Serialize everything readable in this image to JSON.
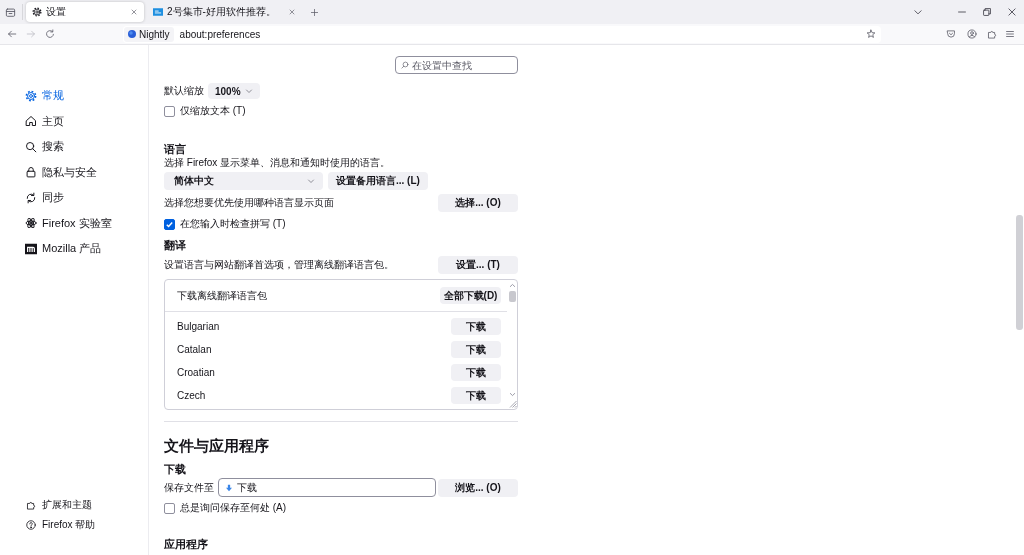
{
  "tabs": [
    {
      "title": "设置",
      "selected": true
    },
    {
      "title": "2号集市-好用软件推荐。",
      "selected": false
    }
  ],
  "toolbar": {
    "nav_buttons": [
      {
        "disabled": false
      },
      {
        "disabled": true
      },
      {
        "disabled": false
      }
    ],
    "identity": "Nightly",
    "url": "about:preferences"
  },
  "sidebar": {
    "items": [
      {
        "label": "常规",
        "selected": true
      },
      {
        "label": "主页",
        "selected": false
      },
      {
        "label": "搜索",
        "selected": false
      },
      {
        "label": "隐私与安全",
        "selected": false
      },
      {
        "label": "同步",
        "selected": false
      },
      {
        "label": "Firefox 实验室",
        "selected": false
      },
      {
        "label": "Mozilla 产品",
        "selected": false
      }
    ],
    "footer_links": [
      "扩展和主题",
      "Firefox 帮助"
    ]
  },
  "search": {
    "placeholder": "在设置中查找"
  },
  "zoom": {
    "label": "默认缩放",
    "value": "100%"
  },
  "zoom_text_only": {
    "label": "仅缩放文本 (T)",
    "checked": false
  },
  "language": {
    "heading": "语言",
    "description": "选择 Firefox 显示菜单、消息和通知时使用的语言。",
    "dropdown": "简体中文",
    "alternatives_button": "设置备用语言... (L)",
    "page_language": {
      "label": "选择您想要优先使用哪种语言显示页面",
      "button": "选择... (O)"
    },
    "spellcheck": {
      "label": "在您输入时检查拼写 (T)",
      "checked": true
    }
  },
  "translation": {
    "heading": "翻译",
    "description": "设置语言与网站翻译首选项，管理离线翻译语言包。",
    "button": "设置... (T)",
    "packs": {
      "title": "下载离线翻译语言包",
      "download_all": "全部下载(D)",
      "rows": [
        {
          "language": "Bulgarian",
          "button": "下载"
        },
        {
          "language": "Catalan",
          "button": "下载"
        },
        {
          "language": "Croatian",
          "button": "下载"
        },
        {
          "language": "Czech",
          "button": "下载"
        }
      ]
    }
  },
  "files": {
    "heading": "文件与应用程序",
    "downloads": {
      "heading": "下载",
      "save_label": "保存文件至",
      "folder": "下载",
      "browse_button": "浏览... (O)",
      "always_ask": {
        "label": "总是询问保存至何处 (A)",
        "checked": false
      }
    },
    "applications_heading": "应用程序"
  }
}
